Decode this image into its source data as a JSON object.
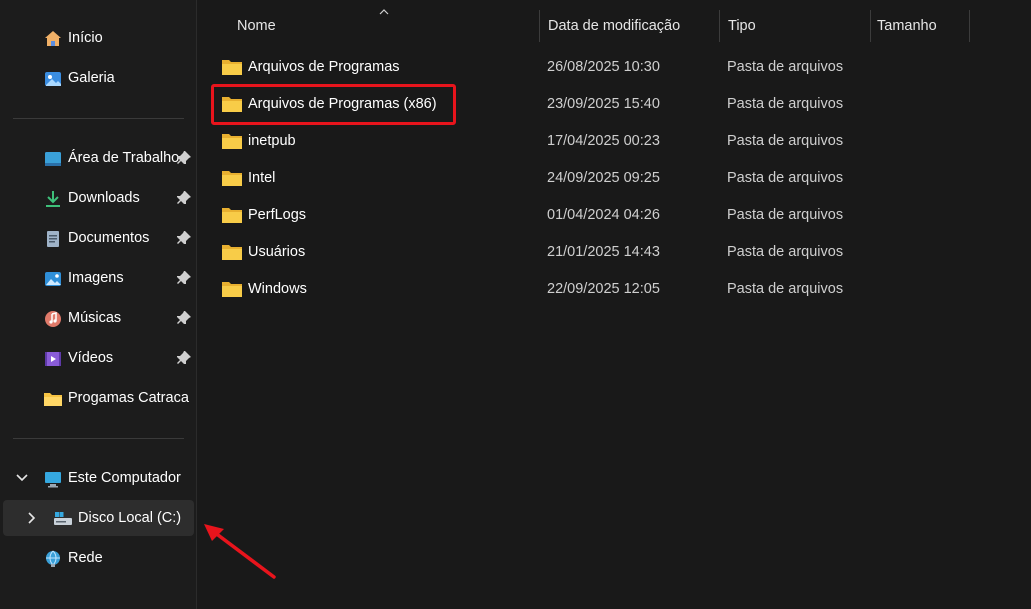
{
  "sidebar": {
    "quick": [
      {
        "label": "Início",
        "icon": "home-icon"
      },
      {
        "label": "Galeria",
        "icon": "gallery-icon"
      }
    ],
    "pinned": [
      {
        "label": "Área de Trabalho",
        "icon": "desktop-icon",
        "pinned": true
      },
      {
        "label": "Downloads",
        "icon": "downloads-icon",
        "pinned": true
      },
      {
        "label": "Documentos",
        "icon": "documents-icon",
        "pinned": true
      },
      {
        "label": "Imagens",
        "icon": "pictures-icon",
        "pinned": true
      },
      {
        "label": "Músicas",
        "icon": "music-icon",
        "pinned": true
      },
      {
        "label": "Vídeos",
        "icon": "videos-icon",
        "pinned": true
      },
      {
        "label": "Progamas Catraca",
        "icon": "folder-icon",
        "pinned": false
      }
    ],
    "this_pc": {
      "label": "Este Computador",
      "icon": "computer-icon",
      "expanded": true
    },
    "local_disk": {
      "label": "Disco Local (C:)",
      "icon": "drive-icon",
      "selected": true
    },
    "network": {
      "label": "Rede",
      "icon": "network-icon"
    }
  },
  "columns": {
    "name": "Nome",
    "date": "Data de modificação",
    "type": "Tipo",
    "size": "Tamanho"
  },
  "files": [
    {
      "name": "Arquivos de Programas",
      "date": "26/08/2025 10:30",
      "type": "Pasta de arquivos"
    },
    {
      "name": "Arquivos de Programas (x86)",
      "date": "23/09/2025 15:40",
      "type": "Pasta de arquivos"
    },
    {
      "name": "inetpub",
      "date": "17/04/2025 00:23",
      "type": "Pasta de arquivos"
    },
    {
      "name": "Intel",
      "date": "24/09/2025 09:25",
      "type": "Pasta de arquivos"
    },
    {
      "name": "PerfLogs",
      "date": "01/04/2024 04:26",
      "type": "Pasta de arquivos"
    },
    {
      "name": "Usuários",
      "date": "21/01/2025 14:43",
      "type": "Pasta de arquivos"
    },
    {
      "name": "Windows",
      "date": "22/09/2025 12:05",
      "type": "Pasta de arquivos"
    }
  ],
  "colors": {
    "background": "#191919",
    "folder": "#f6c343",
    "annotation": "#e8141c",
    "selection": "#2d2d2d"
  }
}
